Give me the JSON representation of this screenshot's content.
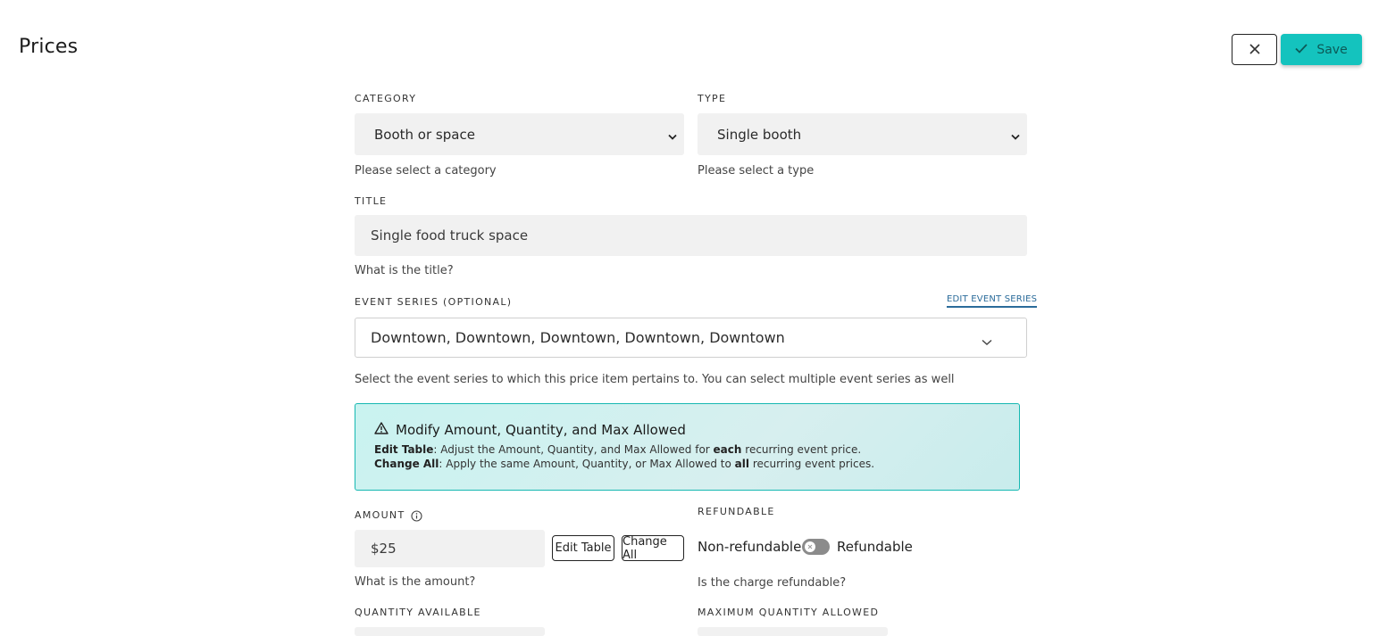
{
  "page": {
    "title": "Prices"
  },
  "header": {
    "save_label": "Save"
  },
  "category": {
    "label": "CATEGORY",
    "value": "Booth or space",
    "helper": "Please select a category"
  },
  "type": {
    "label": "TYPE",
    "value": "Single booth",
    "helper": "Please select a type"
  },
  "title_field": {
    "label": "TITLE",
    "value": "Single food truck space",
    "helper": "What is the title?"
  },
  "event_series": {
    "label": "EVENT SERIES (OPTIONAL)",
    "edit_link": "EDIT EVENT SERIES",
    "value": "Downtown, Downtown, Downtown, Downtown, Downtown",
    "helper": "Select the event series to which this price item pertains to. You can select multiple event series as well"
  },
  "alert": {
    "title": "Modify Amount, Quantity, and Max Allowed",
    "line1_bold": "Edit Table",
    "line1_a": ": Adjust the Amount, Quantity, and Max Allowed for ",
    "line1_em": "each",
    "line1_b": " recurring event price.",
    "line2_bold": "Change All",
    "line2_a": ": Apply the same Amount, Quantity, or Max Allowed to ",
    "line2_em": "all",
    "line2_b": " recurring event prices."
  },
  "amount": {
    "label": "AMOUNT",
    "value": "$25",
    "edit_table": "Edit Table",
    "change_all": "Change All",
    "helper": "What is the amount?"
  },
  "refundable": {
    "label": "REFUNDABLE",
    "off_label": "Non-refundable",
    "on_label": "Refundable",
    "helper": "Is the charge refundable?"
  },
  "quantity": {
    "label": "QUANTITY AVAILABLE"
  },
  "max_quantity": {
    "label": "MAXIMUM QUANTITY ALLOWED"
  }
}
